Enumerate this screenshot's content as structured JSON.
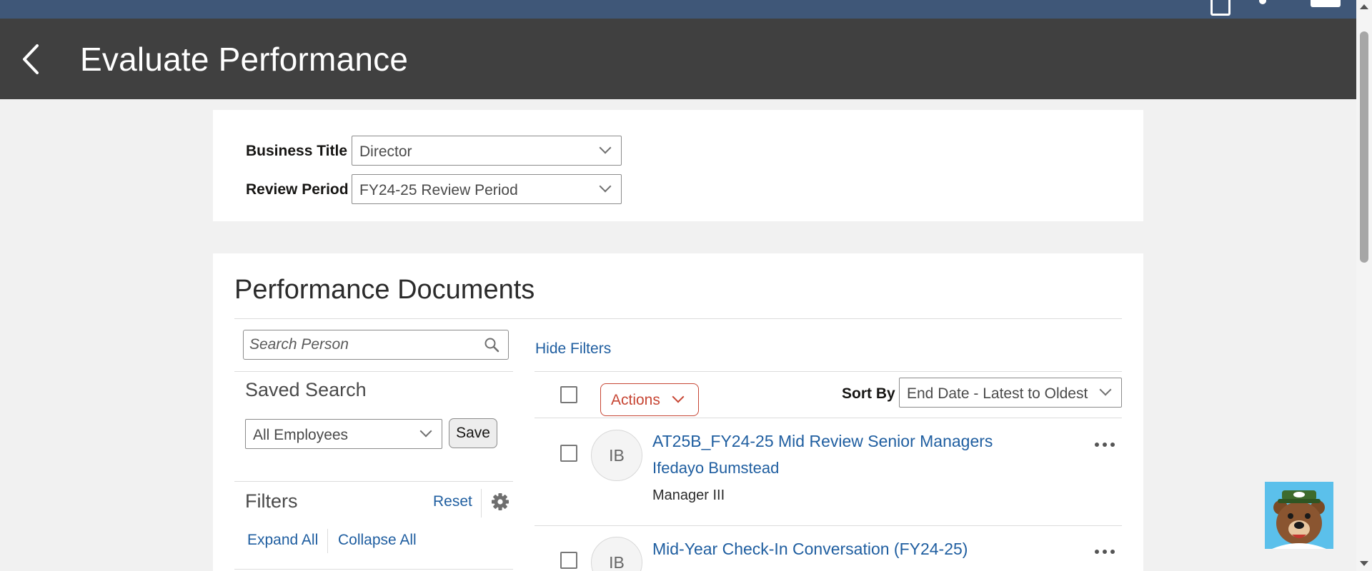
{
  "topbar": {
    "brand": ""
  },
  "header": {
    "title": "Evaluate Performance"
  },
  "filters": {
    "business_title": {
      "label": "Business Title",
      "value": "Director"
    },
    "review_period": {
      "label": "Review Period",
      "value": "FY24-25 Review Period"
    }
  },
  "docs": {
    "title": "Performance Documents",
    "search_placeholder": "Search Person",
    "hide_filters": "Hide Filters",
    "saved_search": {
      "label": "Saved Search",
      "value": "All Employees",
      "save": "Save"
    },
    "filters_section": {
      "label": "Filters",
      "reset": "Reset",
      "expand_all": "Expand All",
      "collapse_all": "Collapse All"
    },
    "actions_label": "Actions",
    "sort": {
      "label": "Sort By",
      "value": "End Date - Latest to Oldest"
    },
    "items": [
      {
        "initials": "IB",
        "title": "AT25B_FY24-25 Mid Review Senior Managers",
        "person": "Ifedayo Bumstead",
        "job": "Manager III"
      },
      {
        "initials": "IB",
        "title": "Mid-Year Check-In Conversation (FY24-25)",
        "person": "",
        "job": ""
      }
    ]
  },
  "colors": {
    "topbar": "#3f5778",
    "titlebar": "#404040",
    "link": "#1f5ea0",
    "actions": "#c74634"
  },
  "icons": {
    "back": "chevron-left-icon",
    "search": "search-icon",
    "settings": "gear-icon",
    "more": "ellipsis-icon"
  }
}
